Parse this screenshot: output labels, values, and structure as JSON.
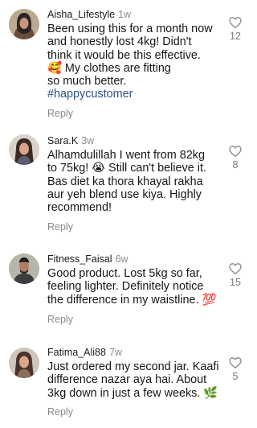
{
  "comments": [
    {
      "username": "Aisha_Lifestyle",
      "time": "1w",
      "lines": [
        "Been using this for a month now",
        "and honestly lost 4kg! Didn't",
        "think it would be this effective.",
        "🥰 My clothes are fitting",
        "so much better."
      ],
      "hashtag": "#happycustomer",
      "likes": "12",
      "reply": "Reply",
      "avatar_icon": "woman-hijab-avatar"
    },
    {
      "username": "Sara.K",
      "time": "3w",
      "lines": [
        "Alhamdulillah I went from 82kg",
        "to 75kg! 😭 Still can't believe it.",
        "Bas diet ka thora khayal rakha",
        "aur yeh blend use kiya. Highly",
        "recommend!"
      ],
      "likes": "8",
      "reply": "Reply",
      "avatar_icon": "woman-long-hair-avatar"
    },
    {
      "username": "Fitness_Faisal",
      "time": "6w",
      "lines": [
        "Good product. Lost 5kg so far,",
        "feeling lighter. Definitely notice",
        "the difference in my waistline. 💯"
      ],
      "likes": "15",
      "reply": "Reply",
      "avatar_icon": "man-avatar"
    },
    {
      "username": "Fatima_Ali88",
      "time": "7w",
      "lines": [
        "Just ordered my second jar. Kaafi",
        "difference nazar aya hai. About",
        "3kg down in just a few weeks. 🌿"
      ],
      "likes": "5",
      "reply": "Reply",
      "avatar_icon": "woman-long-hair-avatar"
    }
  ]
}
